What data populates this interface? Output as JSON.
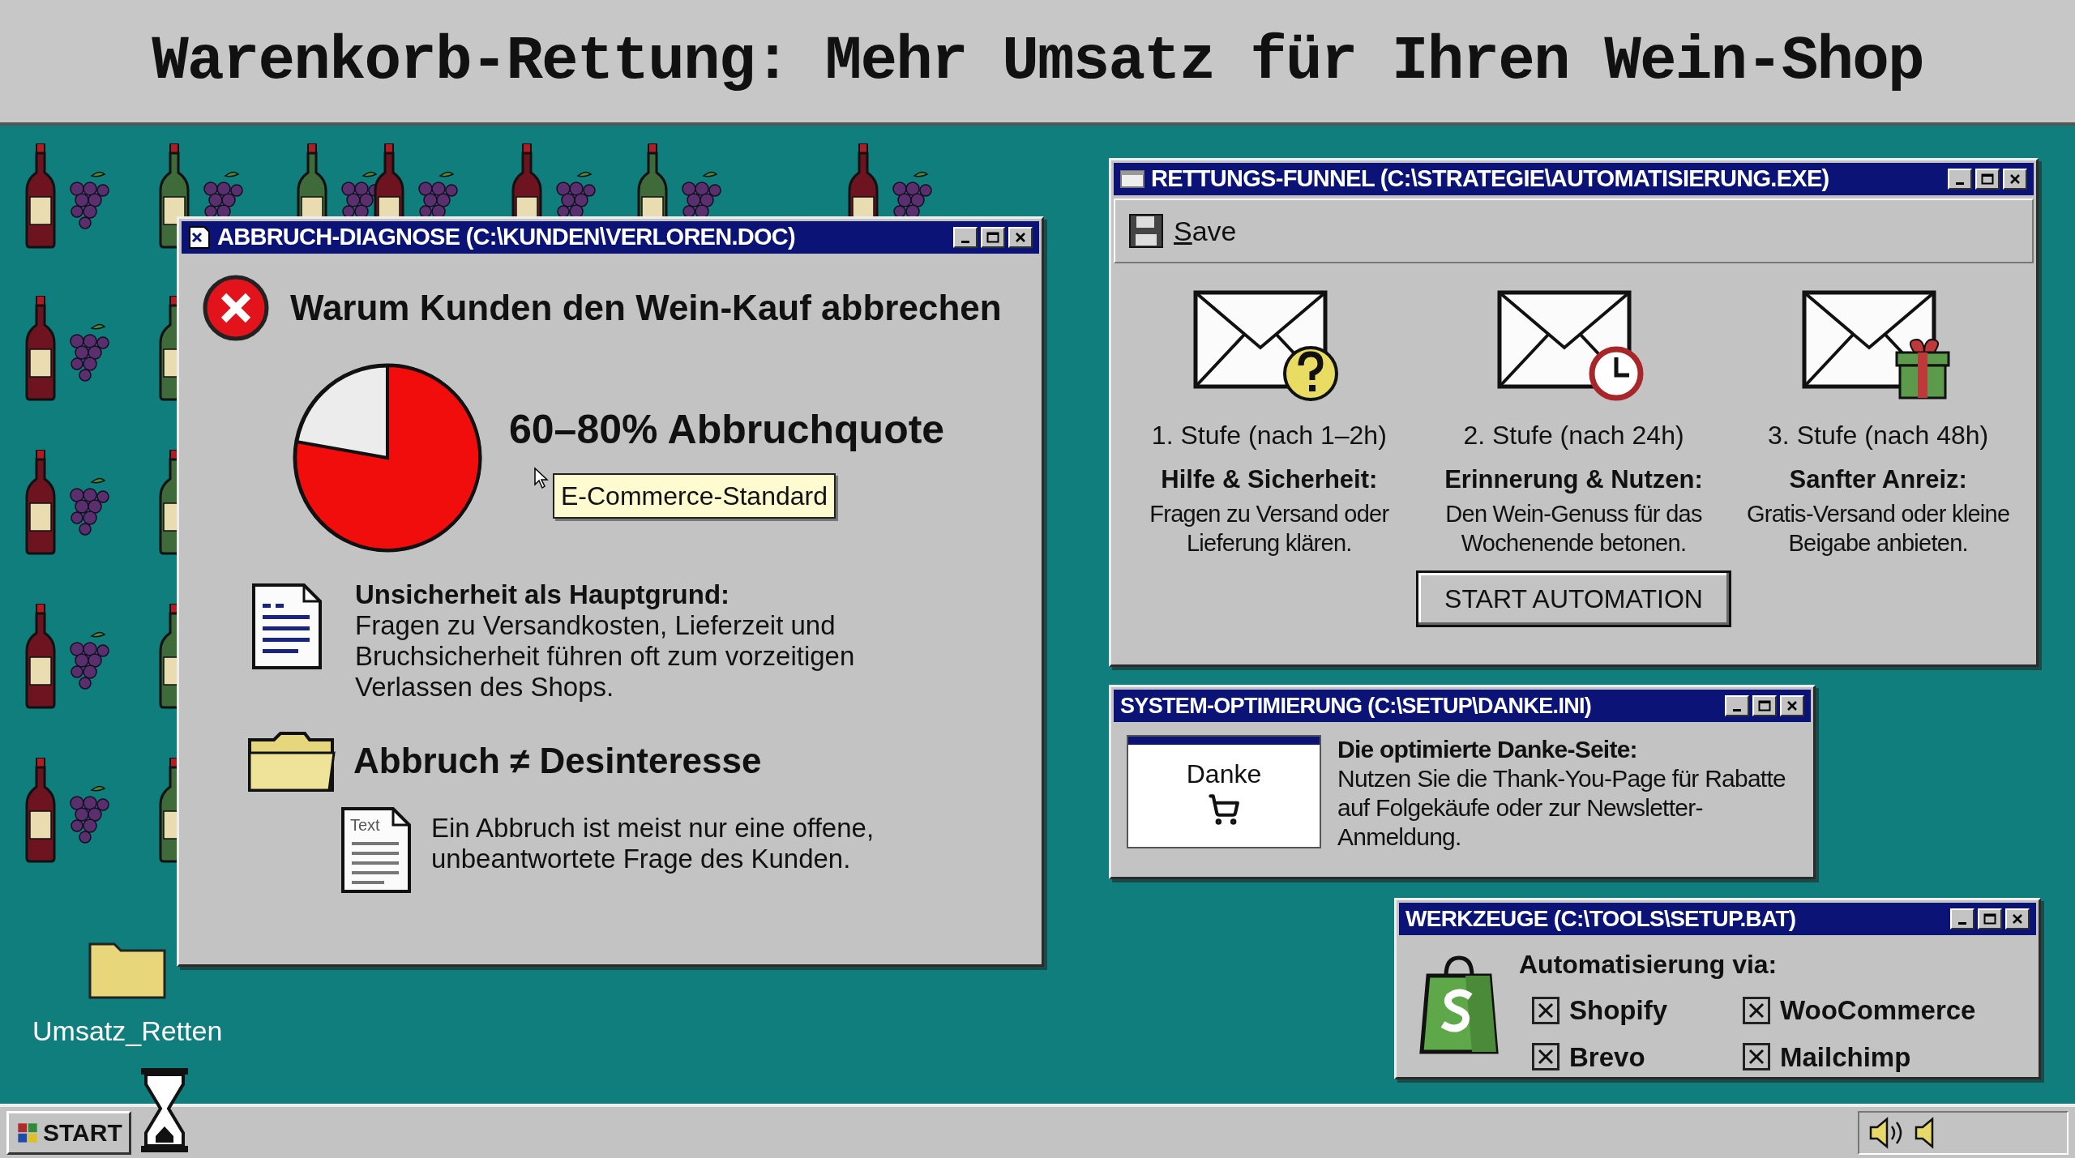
{
  "header": {
    "title": "Warenkorb-Rettung: Mehr Umsatz für Ihren Wein-Shop"
  },
  "diagnosis_window": {
    "title": "ABBRUCH-DIAGNOSE (C:\\KUNDEN\\VERLOREN.DOC)",
    "heading": "Warum Kunden den Wein-Kauf abbrechen",
    "stat": "60–80% Abbruchquote",
    "tooltip": "E-Commerce-Standard",
    "cause": {
      "title": "Unsicherheit als Hauptgrund:",
      "text": "Fragen zu Versandkosten, Lieferzeit und Bruchsicherheit führen oft zum vorzeitigen Verlassen des Shops."
    },
    "insight": {
      "title": "Abbruch ≠ Desinteresse",
      "file_label": "Text",
      "text": "Ein Abbruch ist meist nur eine offene, unbeantwortete Frage des Kunden."
    }
  },
  "funnel_window": {
    "title": "RETTUNGS-FUNNEL (C:\\STRATEGIE\\AUTOMATISIERUNG.EXE)",
    "save": "Save",
    "stages": [
      {
        "kind": "question",
        "label": "1. Stufe (nach 1–2h)",
        "title": "Hilfe & Sicherheit:",
        "text": "Fragen zu Versand oder Lieferung klären."
      },
      {
        "kind": "clock",
        "label": "2. Stufe (nach 24h)",
        "title": "Erinnerung & Nutzen:",
        "text": "Den Wein-Genuss für das Wochenende betonen."
      },
      {
        "kind": "gift",
        "label": "3. Stufe (nach 48h)",
        "title": "Sanfter Anreiz:",
        "text": "Gratis-Versand oder kleine Beigabe anbieten."
      }
    ],
    "button": "START AUTOMATION"
  },
  "thanks_window": {
    "title": "SYSTEM-OPTIMIERUNG (C:\\SETUP\\DANKE.INI)",
    "preview_label": "Danke",
    "heading": "Die optimierte Danke-Seite:",
    "text": "Nutzen Sie die Thank-You-Page für Rabatte auf Folgekäufe oder zur Newsletter-Anmeldung."
  },
  "tools_window": {
    "title": "WERKZEUGE (C:\\TOOLS\\SETUP.BAT)",
    "heading": "Automatisierung via:",
    "options": [
      {
        "label": "Shopify",
        "checked": true
      },
      {
        "label": "WooCommerce",
        "checked": true
      },
      {
        "label": "Brevo",
        "checked": true
      },
      {
        "label": "Mailchimp",
        "checked": true
      }
    ]
  },
  "desktop": {
    "folder_label": "Umsatz_Retten"
  },
  "taskbar": {
    "start": "START"
  }
}
